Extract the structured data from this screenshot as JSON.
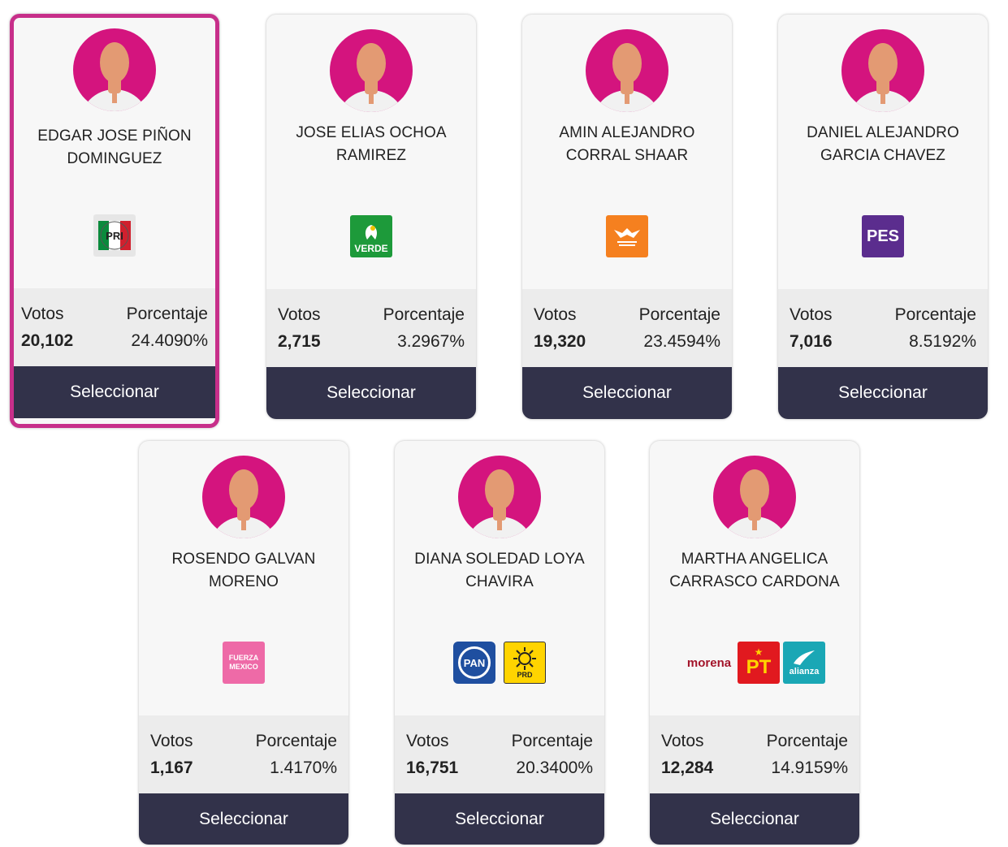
{
  "colors": {
    "accent": "#c72f8a",
    "avatar_bg": "#d4147e",
    "button_bg": "#32324a"
  },
  "labels": {
    "votes": "Votos",
    "percentage": "Porcentaje",
    "select": "Seleccionar"
  },
  "candidates": [
    {
      "name_line1": "EDGAR JOSE PIÑON",
      "name_line2": "DOMINGUEZ",
      "votes": "20,102",
      "percentage": "24.4090%",
      "selected": true,
      "parties": [
        {
          "name": "PRI",
          "logo_text": "PRI",
          "icon": "pri-logo-icon"
        }
      ]
    },
    {
      "name_line1": "JOSE ELIAS OCHOA",
      "name_line2": "RAMIREZ",
      "votes": "2,715",
      "percentage": "3.2967%",
      "selected": false,
      "parties": [
        {
          "name": "Partido Verde",
          "logo_text": "VERDE",
          "icon": "verde-logo-icon"
        }
      ]
    },
    {
      "name_line1": "AMIN ALEJANDRO",
      "name_line2": "CORRAL SHAAR",
      "votes": "19,320",
      "percentage": "23.4594%",
      "selected": false,
      "parties": [
        {
          "name": "Movimiento Ciudadano",
          "logo_text": "",
          "icon": "movimiento-ciudadano-logo-icon"
        }
      ]
    },
    {
      "name_line1": "DANIEL ALEJANDRO",
      "name_line2": "GARCIA CHAVEZ",
      "votes": "7,016",
      "percentage": "8.5192%",
      "selected": false,
      "parties": [
        {
          "name": "PES",
          "logo_text": "PES",
          "icon": "pes-logo-icon"
        }
      ]
    },
    {
      "name_line1": "ROSENDO GALVAN",
      "name_line2": "MORENO",
      "votes": "1,167",
      "percentage": "1.4170%",
      "selected": false,
      "parties": [
        {
          "name": "Fuerza por México",
          "logo_text": "FUERZA MEXICO",
          "icon": "fuerza-mexico-logo-icon"
        }
      ]
    },
    {
      "name_line1": "DIANA SOLEDAD LOYA",
      "name_line2": "CHAVIRA",
      "votes": "16,751",
      "percentage": "20.3400%",
      "selected": false,
      "parties": [
        {
          "name": "PAN",
          "logo_text": "PAN",
          "icon": "pan-logo-icon"
        },
        {
          "name": "PRD",
          "logo_text": "PRD",
          "icon": "prd-logo-icon"
        }
      ]
    },
    {
      "name_line1": "MARTHA ANGELICA",
      "name_line2": "CARRASCO CARDONA",
      "votes": "12,284",
      "percentage": "14.9159%",
      "selected": false,
      "parties": [
        {
          "name": "morena",
          "logo_text": "morena",
          "icon": "morena-logo-icon"
        },
        {
          "name": "PT",
          "logo_text": "PT",
          "icon": "pt-logo-icon"
        },
        {
          "name": "Nueva Alianza",
          "logo_text": "alianza",
          "icon": "nueva-alianza-logo-icon"
        }
      ]
    }
  ]
}
